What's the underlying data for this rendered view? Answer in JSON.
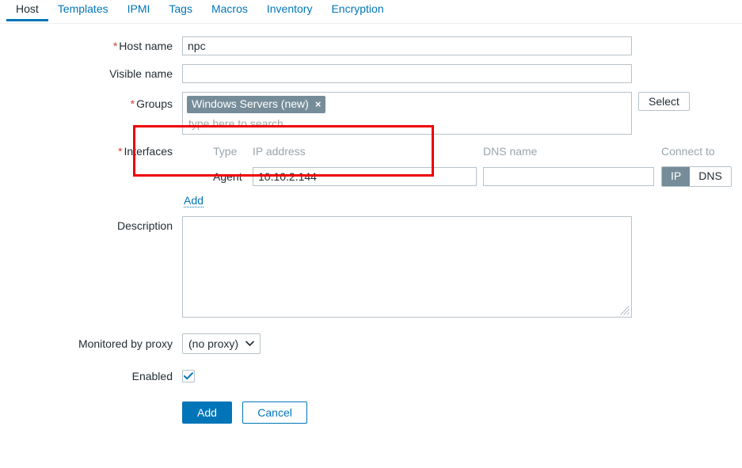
{
  "tabs": [
    {
      "label": "Host",
      "active": true
    },
    {
      "label": "Templates",
      "active": false
    },
    {
      "label": "IPMI",
      "active": false
    },
    {
      "label": "Tags",
      "active": false
    },
    {
      "label": "Macros",
      "active": false
    },
    {
      "label": "Inventory",
      "active": false
    },
    {
      "label": "Encryption",
      "active": false
    }
  ],
  "form": {
    "host_name": {
      "label": "Host name",
      "value": "npc",
      "required_marker": "*"
    },
    "visible_name": {
      "label": "Visible name",
      "value": ""
    },
    "groups": {
      "label": "Groups",
      "required_marker": "*",
      "chips": [
        {
          "text": "Windows Servers (new)",
          "remove_icon": "×"
        }
      ],
      "placeholder": "type here to search",
      "select_button": "Select"
    },
    "interfaces": {
      "label": "Interfaces",
      "required_marker": "*",
      "columns": {
        "type": "Type",
        "ip_address": "IP address",
        "dns_name": "DNS name",
        "connect_to": "Connect to"
      },
      "rows": [
        {
          "type": "Agent",
          "ip_address": "10.10.2.144",
          "dns_name": "",
          "connect_to_options": [
            "IP",
            "DNS"
          ],
          "connect_to_selected": "IP"
        }
      ],
      "add_link": "Add"
    },
    "description": {
      "label": "Description",
      "value": ""
    },
    "monitored_by_proxy": {
      "label": "Monitored by proxy",
      "selected": "(no proxy)",
      "options": [
        "(no proxy)"
      ]
    },
    "enabled": {
      "label": "Enabled",
      "checked": true
    }
  },
  "footer": {
    "submit_label": "Add",
    "cancel_label": "Cancel"
  },
  "colors": {
    "accent_blue": "#0275b8",
    "chip_gray": "#768d99",
    "required_red": "#d23f31",
    "highlight_red": "#ee0000",
    "border_gray": "#b6c2c9",
    "muted_text": "#97a5ad"
  }
}
